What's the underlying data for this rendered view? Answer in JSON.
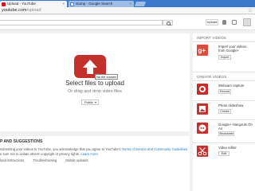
{
  "browser": {
    "tabs": [
      {
        "label": "Upload - YouTube"
      },
      {
        "label": "stump - Google Search"
      }
    ],
    "url": {
      "host": "youtube.com",
      "path": "/upload"
    }
  },
  "header": {
    "upload_label": "Upload"
  },
  "upload": {
    "tooltip": "No file chosen",
    "title": "Select files to upload",
    "subtitle": "Or drag and drop video files",
    "privacy": "Public"
  },
  "help": {
    "title": "P AND SUGGESTIONS",
    "body_1": "submitting your videos to YouTube, you acknowledge that you agree to YouTube's ",
    "body_link": "Terms of Service and Community Guidelines",
    "body_2": "e sure not to violate others' copyright or privacy rights. ",
    "body_learn": "Learn more",
    "links": [
      "load instructions",
      "Troubleshooting",
      "Mobile uploads"
    ]
  },
  "sidebar": {
    "import_heading": "IMPORT VIDEOS",
    "import_desc": "Import your videos from Google+",
    "import_btn": "Import",
    "create_heading": "CREATE VIDEOS",
    "items": [
      {
        "label": "Webcam capture",
        "button": "Record",
        "icon": "webcam-icon"
      },
      {
        "label": "Photo slideshow",
        "button": "Create",
        "icon": "photo-slideshow-icon"
      },
      {
        "label": "Google+ Hangouts On Air",
        "button": "Broadcast",
        "icon": "hangouts-icon"
      },
      {
        "label": "Video editor",
        "button": "Edit",
        "icon": "scissors-icon"
      }
    ]
  },
  "colors": {
    "brand_red": "#c4302b",
    "tab_blue": "#3b78c9",
    "link_blue": "#167ac6"
  }
}
